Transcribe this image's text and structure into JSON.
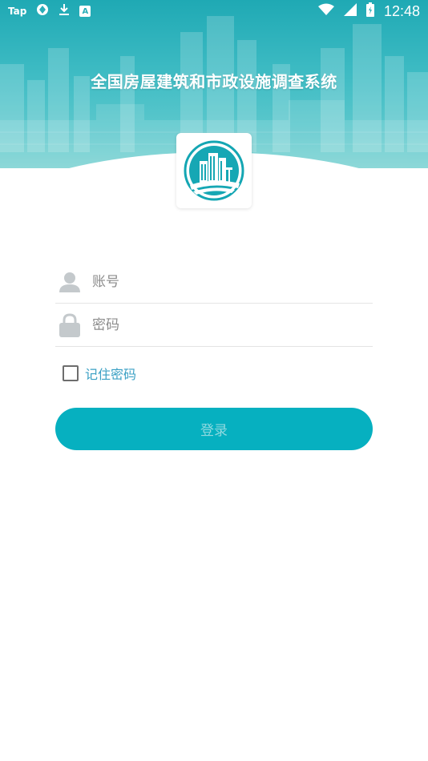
{
  "status_bar": {
    "tap_label": "Tap",
    "a_label": "A",
    "time": "12:48",
    "icons": [
      "tap-app-icon",
      "sync-icon",
      "download-icon",
      "a-app-icon",
      "wifi-icon",
      "signal-icon",
      "battery-icon"
    ]
  },
  "header": {
    "title": "全国房屋建筑和市政设施调查系统"
  },
  "form": {
    "account_placeholder": "账号",
    "password_placeholder": "密码",
    "remember_label": "记住密码",
    "remember_checked": false,
    "login_label": "登录"
  },
  "colors": {
    "accent": "#06b0c0",
    "link": "#3aa0c4",
    "banner_top": "#1fa9b4",
    "icon_gray": "#c4c9cc"
  }
}
